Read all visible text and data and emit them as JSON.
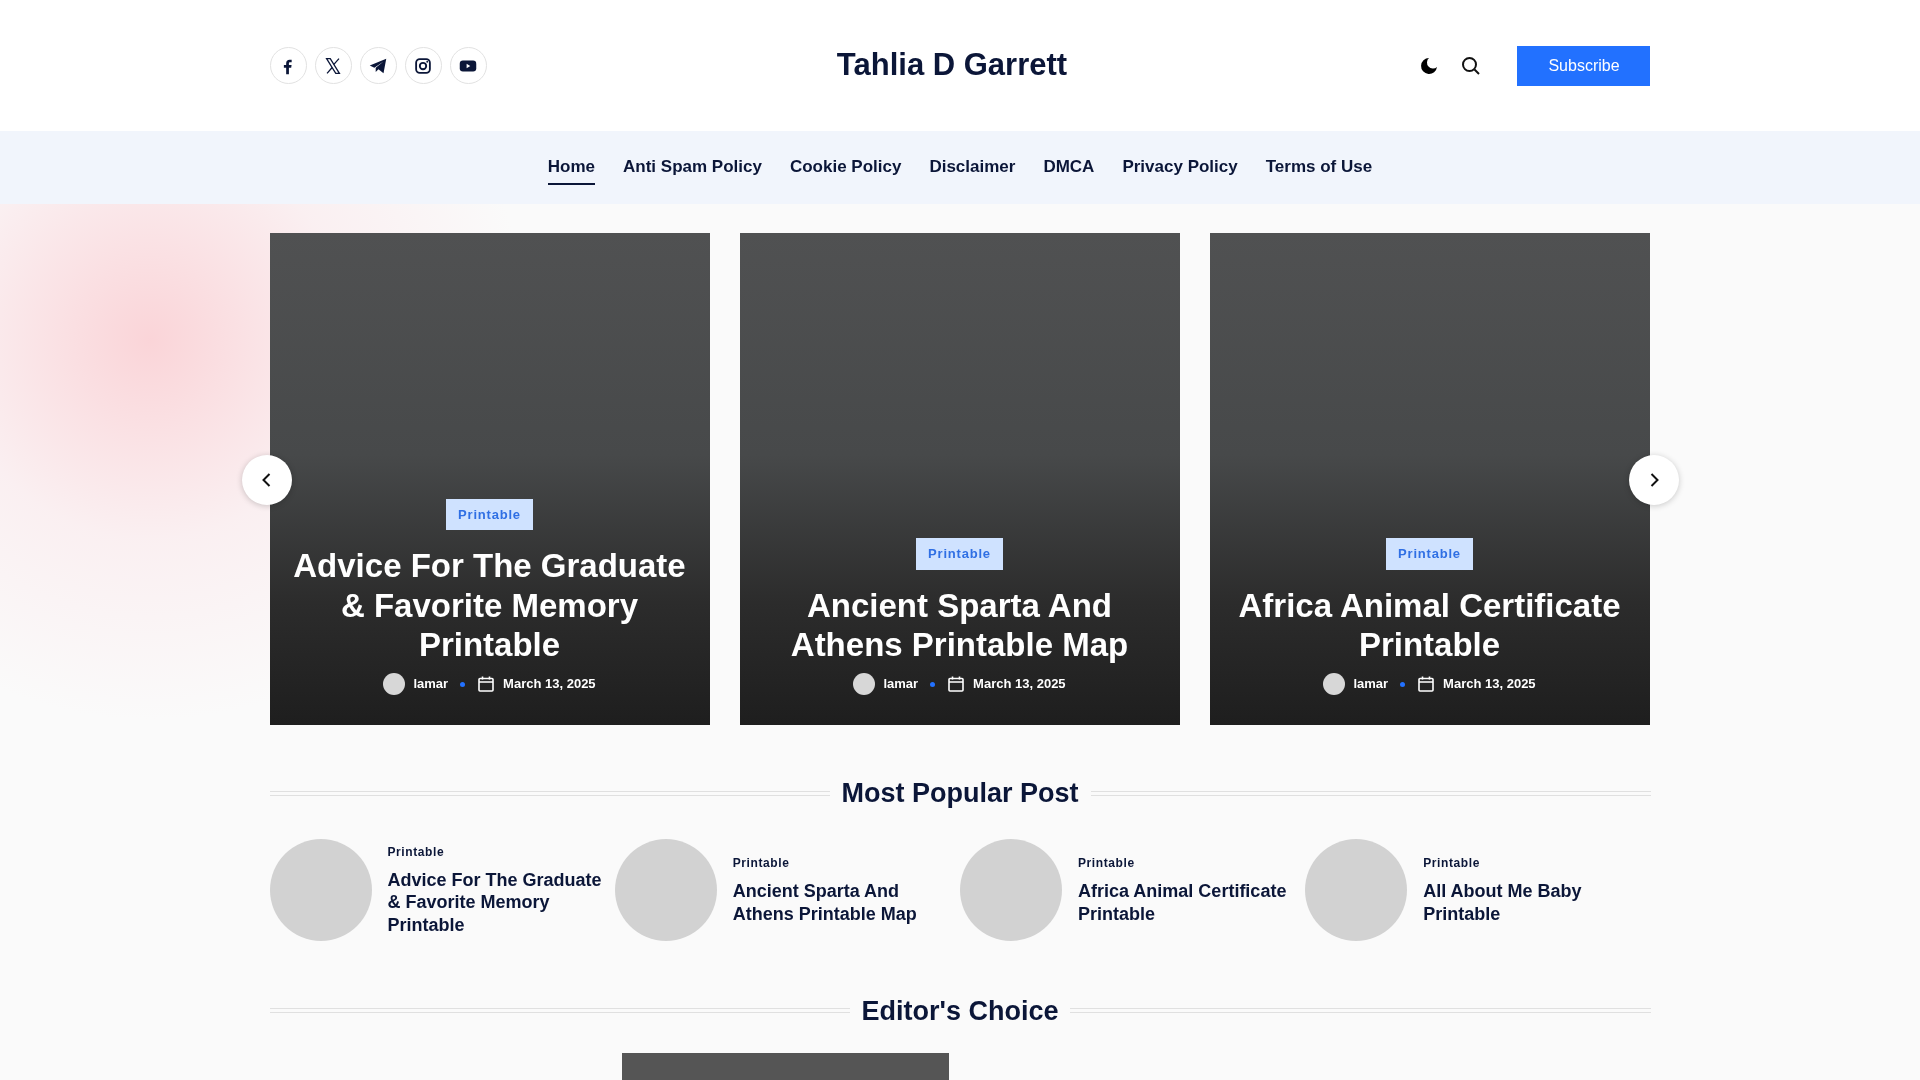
{
  "site": {
    "title": "Tahlia D Garrett"
  },
  "header": {
    "subscribe": "Subscribe"
  },
  "nav": [
    {
      "label": "Home",
      "selected": true
    },
    {
      "label": "Anti Spam Policy",
      "selected": false
    },
    {
      "label": "Cookie Policy",
      "selected": false
    },
    {
      "label": "Disclaimer",
      "selected": false
    },
    {
      "label": "DMCA",
      "selected": false
    },
    {
      "label": "Privacy Policy",
      "selected": false
    },
    {
      "label": "Terms of Use",
      "selected": false
    }
  ],
  "slides": [
    {
      "category": "Printable",
      "title": "Advice For The Graduate & Favorite Memory Printable",
      "author": "lamar",
      "date": "March 13, 2025"
    },
    {
      "category": "Printable",
      "title": "Ancient Sparta And Athens Printable Map",
      "author": "lamar",
      "date": "March 13, 2025"
    },
    {
      "category": "Printable",
      "title": "Africa Animal Certificate Printable",
      "author": "lamar",
      "date": "March 13, 2025"
    }
  ],
  "popular": {
    "heading": "Most Popular Post",
    "items": [
      {
        "category": "Printable",
        "title": "Advice For The Graduate & Favorite Memory Printable"
      },
      {
        "category": "Printable",
        "title": "Ancient Sparta And Athens Printable Map"
      },
      {
        "category": "Printable",
        "title": "Africa Animal Certificate Printable"
      },
      {
        "category": "Printable",
        "title": "All About Me Baby Printable"
      }
    ]
  },
  "editors": {
    "heading": "Editor's Choice"
  }
}
